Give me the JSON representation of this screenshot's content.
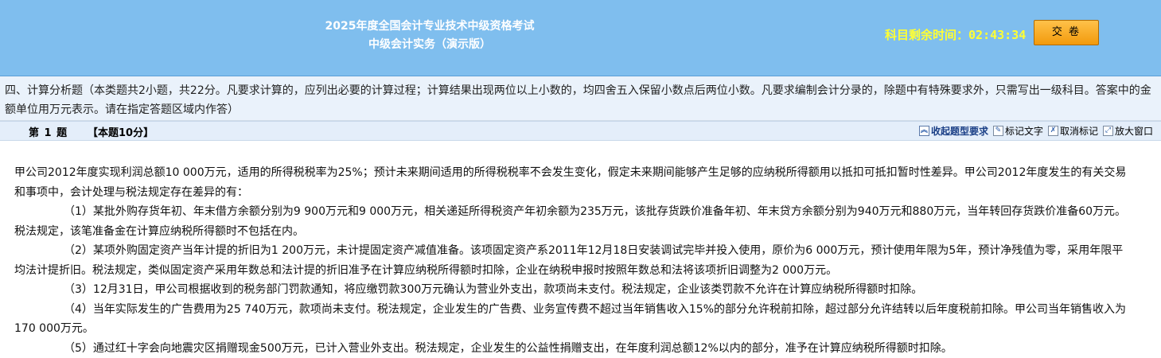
{
  "header": {
    "exam_title": "2025年度全国会计专业技术中级资格考试",
    "subject": "中级会计实务（演示版）",
    "timer_label": "科目剩余时间：",
    "timer_value": "02:43:34",
    "submit_label": "交 卷"
  },
  "section": {
    "instructions": "四、计算分析题（本类题共2小题，共22分。凡要求计算的，应列出必要的计算过程；计算结果出现两位以上小数的，均四舍五入保留小数点后两位小数。凡要求编制会计分录的，除题中有特殊要求外，只需写出一级科目。答案中的金额单位用万元表示。请在指定答题区域内作答）"
  },
  "question": {
    "number": "第 1 题",
    "score": "【本题10分】",
    "tools": {
      "collapse": "收起题型要求",
      "mark_text": "标记文字",
      "unmark": "取消标记",
      "enlarge": "放大窗口"
    },
    "paragraphs": [
      "甲公司2012年度实现利润总额10 000万元，适用的所得税税率为25%；预计未来期间适用的所得税税率不会发生变化，假定未来期间能够产生足够的应纳税所得额用以抵扣可抵扣暂时性差异。甲公司2012年度发生的有关交易和事项中，会计处理与税法规定存在差异的有：",
      "（1）某批外购存货年初、年末借方余额分别为9 900万元和9 000万元，相关递延所得税资产年初余额为235万元，该批存货跌价准备年初、年末贷方余额分别为940万元和880万元，当年转回存货跌价准备60万元。税法规定，该笔准备金在计算应纳税所得额时不包括在内。",
      "（2）某项外购固定资产当年计提的折旧为1 200万元，未计提固定资产减值准备。该项固定资产系2011年12月18日安装调试完毕并投入使用，原价为6 000万元，预计使用年限为5年，预计净残值为零，采用年限平均法计提折旧。税法规定，类似固定资产采用年数总和法计提的折旧准予在计算应纳税所得额时扣除，企业在纳税申报时按照年数总和法将该项折旧调整为2 000万元。",
      "（3）12月31日，甲公司根据收到的税务部门罚款通知，将应缴罚款300万元确认为营业外支出，款项尚未支付。税法规定，企业该类罚款不允许在计算应纳税所得额时扣除。",
      "（4）当年实际发生的广告费用为25 740万元，款项尚未支付。税法规定，企业发生的广告费、业务宣传费不超过当年销售收入15%的部分允许税前扣除，超过部分允许结转以后年度税前扣除。甲公司当年销售收入为170 000万元。",
      "（5）通过红十字会向地震灾区捐赠现金500万元，已计入营业外支出。税法规定，企业发生的公益性捐赠支出，在年度利润总额12%以内的部分，准予在计算应纳税所得额时扣除。"
    ]
  }
}
